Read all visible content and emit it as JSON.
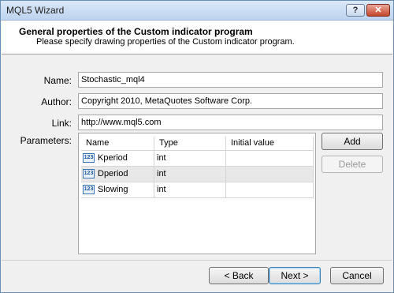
{
  "window": {
    "title": "MQL5 Wizard",
    "help_label": "?",
    "close_label": "✕"
  },
  "header": {
    "title": "General properties of the Custom indicator program",
    "subtitle": "Please specify drawing properties of the Custom indicator program."
  },
  "form": {
    "name_label": "Name:",
    "name_value": "Stochastic_mql4",
    "author_label": "Author:",
    "author_value": "Copyright 2010, MetaQuotes Software Corp.",
    "link_label": "Link:",
    "link_value": "http://www.mql5.com",
    "parameters_label": "Parameters:"
  },
  "parameters": {
    "columns": [
      "Name",
      "Type",
      "Initial value"
    ],
    "rows": [
      {
        "name": "Kperiod",
        "type": "int",
        "initial": "",
        "icon": "int-type-icon"
      },
      {
        "name": "Dperiod",
        "type": "int",
        "initial": "",
        "icon": "int-type-icon"
      },
      {
        "name": "Slowing",
        "type": "int",
        "initial": "",
        "icon": "int-type-icon"
      }
    ],
    "icon_text": "123"
  },
  "side_buttons": {
    "add": "Add",
    "delete": "Delete"
  },
  "footer": {
    "back": "< Back",
    "next": "Next >",
    "cancel": "Cancel"
  }
}
